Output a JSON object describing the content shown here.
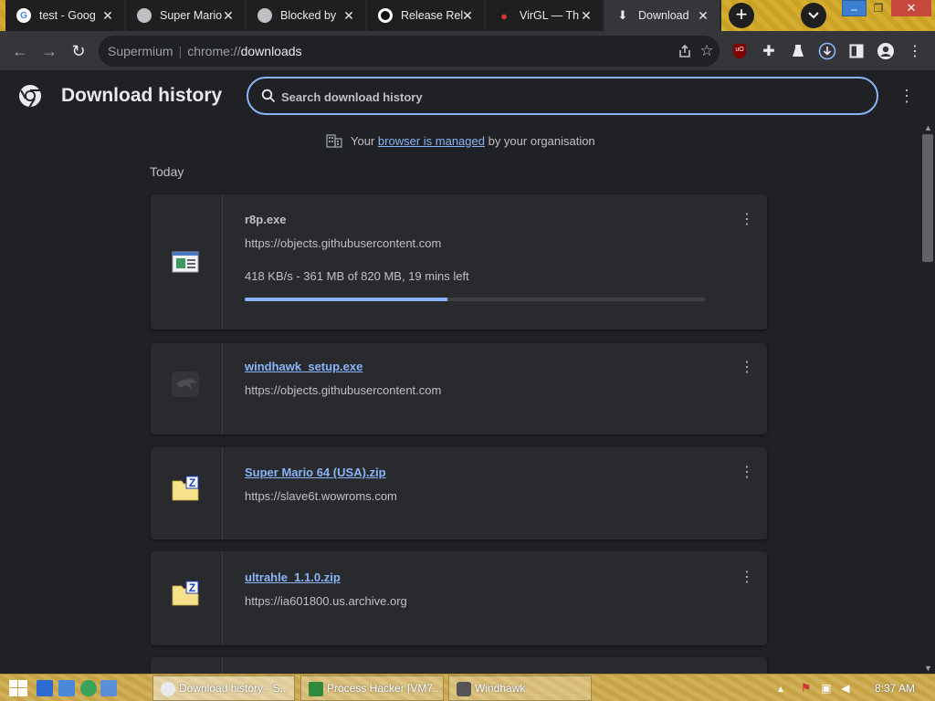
{
  "tabs": [
    {
      "title": "test - Goog",
      "icon": "google-icon"
    },
    {
      "title": "Super Mario",
      "icon": "globe-icon"
    },
    {
      "title": "Blocked by",
      "icon": "globe-icon"
    },
    {
      "title": "Release Rel",
      "icon": "github-icon"
    },
    {
      "title": "VirGL — Th",
      "icon": "virgl-icon"
    },
    {
      "title": "Download",
      "icon": "download-icon"
    }
  ],
  "address": {
    "site": "Supermium",
    "scheme": "chrome://",
    "path": "downloads"
  },
  "page": {
    "title": "Download history",
    "search_placeholder": "Search download history",
    "managed_prefix": "Your",
    "managed_link": "browser is managed",
    "managed_suffix": "by your organisation",
    "section_label": "Today"
  },
  "downloads": [
    {
      "name": "r8p.exe",
      "url": "https://objects.githubusercontent.com",
      "status": "418 KB/s - 361 MB of 820 MB, 19 mins left",
      "progress": 0.44,
      "icon": "exe-window-icon"
    },
    {
      "name": "windhawk_setup.exe",
      "url": "https://objects.githubusercontent.com",
      "icon": "windhawk-icon"
    },
    {
      "name": "Super Mario 64 (USA).zip",
      "url": "https://slave6t.wowroms.com",
      "icon": "zip-folder-icon"
    },
    {
      "name": "ultrahle_1.1.0.zip",
      "url": "https://ia601800.us.archive.org",
      "icon": "zip-folder-icon"
    }
  ],
  "taskbar": {
    "tasks": [
      {
        "label": "Download history - S...",
        "icon": "chrome-icon"
      },
      {
        "label": "Process Hacker [VM7...",
        "icon": "process-hacker-icon"
      },
      {
        "label": "Windhawk",
        "icon": "windhawk-icon"
      }
    ],
    "clock": "8:37 AM"
  },
  "colors": {
    "accent": "#8ab4f8",
    "page_bg": "#202124",
    "card_bg": "#292a2d",
    "toolbar_bg": "#35363a"
  }
}
